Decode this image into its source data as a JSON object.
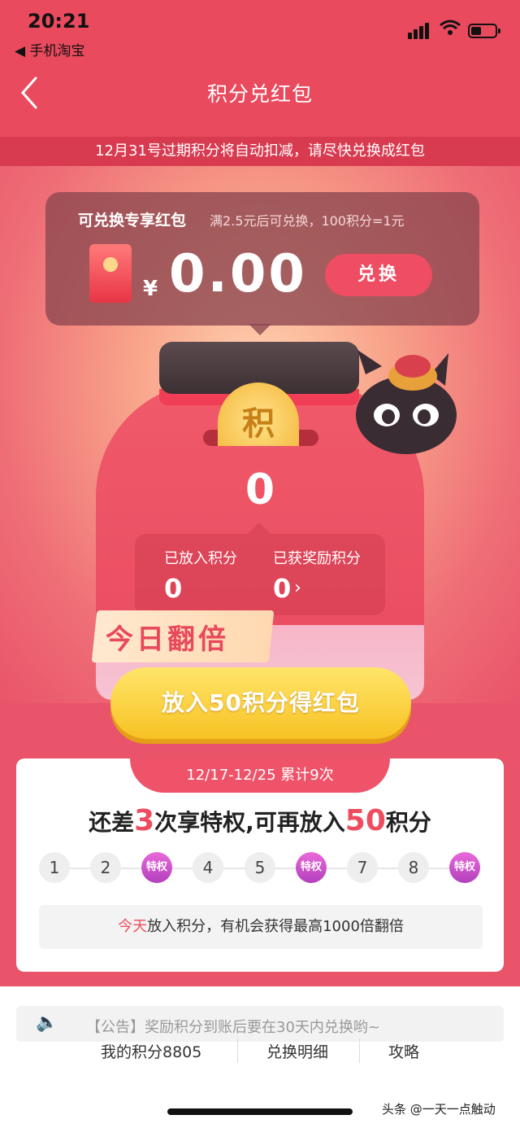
{
  "status_bar": {
    "time": "20:21",
    "back_app": "◀ 手机淘宝"
  },
  "nav": {
    "title": "积分兑红包"
  },
  "notice": "12月31号过期积分将自动扣减，请尽快兑换成红包",
  "exchange_card": {
    "title": "可兑换专享红包",
    "subtitle": "满2.5元后可兑换，100积分=1元",
    "currency": "¥",
    "amount": "0.00",
    "button": "兑换"
  },
  "jar": {
    "coin_char": "积",
    "points": "0",
    "deposited_label": "已放入积分",
    "deposited_value": "0",
    "reward_label": "已获奖励积分",
    "reward_value": "0",
    "ribbon": "今日翻倍"
  },
  "action_button": "放入50积分得红包",
  "progress": {
    "period": "12/17-12/25 累计9次",
    "headline_pre": "还差",
    "headline_num1": "3",
    "headline_mid": "次享特权,可再放入",
    "headline_num2": "50",
    "headline_post": "积分",
    "steps": [
      "1",
      "2",
      "特权",
      "4",
      "5",
      "特权",
      "7",
      "8",
      "特权"
    ],
    "tip_highlight": "今天",
    "tip_rest": "放入积分，有机会获得最高1000倍翻倍"
  },
  "announcement": "【公告】奖励积分到账后要在30天内兑换哟~",
  "footer": {
    "my_points": "我的积分8805",
    "detail": "兑换明细",
    "guide": "攻略"
  },
  "watermark": "头条 @一天一点触动",
  "colors": {
    "primary": "#ea4a5e",
    "accent_yellow": "#f7c223",
    "privilege": "#b23fbd"
  }
}
